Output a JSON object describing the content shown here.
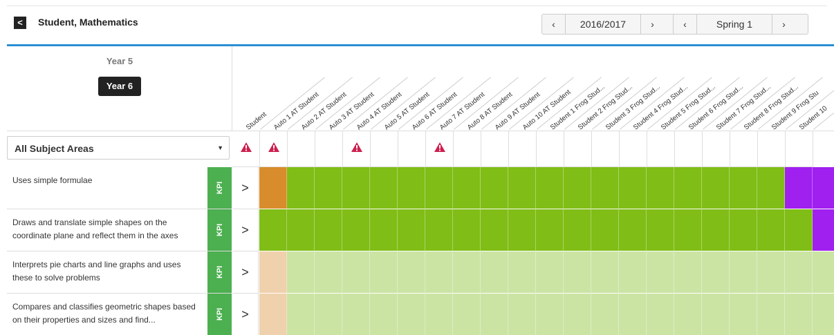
{
  "header": {
    "back_glyph": "<",
    "title": "Student, Mathematics",
    "year_value": "2016/2017",
    "term_value": "Spring 1",
    "prev_glyph": "‹",
    "next_glyph": "›"
  },
  "year_filter": {
    "inactive": "Year 5",
    "active": "Year 6"
  },
  "subject_filter": {
    "selected": "All Subject Areas",
    "caret": "▼"
  },
  "columns": [
    "Student",
    "Auto 1 AT Student",
    "Auto 2 AT Student",
    "Auto 3 AT Student",
    "Auto 4 AT Student",
    "Auto 5 AT Student",
    "Auto 6 AT Student",
    "Auto 7 AT Student",
    "Auto 8 AT Student",
    "Auto 9 AT Student",
    "Auto 10 AT Student",
    "Student 1 Frog Stud...",
    "Student 2 Frog Stud...",
    "Student 3 Frog Stud...",
    "Student 4 Frog Stud...",
    "Student 5 Frog Stud...",
    "Student 6 Frog Stud...",
    "Student 7 Frog Stud...",
    "Student 8 Frog Stud...",
    "Student 9 Frog Stu",
    "Student 10"
  ],
  "warning_flags": [
    true,
    true,
    false,
    false,
    true,
    false,
    false,
    true,
    false,
    false,
    false,
    false,
    false,
    false,
    false,
    false,
    false,
    false,
    false,
    false,
    false
  ],
  "colors": {
    "warning": "#cc1f4f",
    "orange": "#d98c2b",
    "green": "#80bd16",
    "purple": "#a020f0",
    "light_orange": "#f0d1ad",
    "light_green": "#cbe4a4",
    "kpi": "#4caf50",
    "accent": "#2a8fd4"
  },
  "rows": [
    {
      "description": "Uses simple formulae",
      "kpi": "KPI",
      "chevron": ">",
      "cells": [
        "orange",
        "green",
        "green",
        "green",
        "green",
        "green",
        "green",
        "green",
        "green",
        "green",
        "green",
        "green",
        "green",
        "green",
        "green",
        "green",
        "green",
        "green",
        "green",
        "purple",
        "purple"
      ]
    },
    {
      "description": "Draws and translate simple shapes on the coordinate plane and reflect them in the axes",
      "kpi": "KPI",
      "chevron": ">",
      "cells": [
        "green",
        "green",
        "green",
        "green",
        "green",
        "green",
        "green",
        "green",
        "green",
        "green",
        "green",
        "green",
        "green",
        "green",
        "green",
        "green",
        "green",
        "green",
        "green",
        "green",
        "purple"
      ]
    },
    {
      "description": "Interprets pie charts and line graphs and uses these to solve problems",
      "kpi": "KPI",
      "chevron": ">",
      "cells": [
        "light_orange",
        "light_green",
        "light_green",
        "light_green",
        "light_green",
        "light_green",
        "light_green",
        "light_green",
        "light_green",
        "light_green",
        "light_green",
        "light_green",
        "light_green",
        "light_green",
        "light_green",
        "light_green",
        "light_green",
        "light_green",
        "light_green",
        "light_green",
        "light_green"
      ]
    },
    {
      "description": "Compares and classifies geometric shapes based on their properties and sizes and find...",
      "kpi": "KPI",
      "chevron": ">",
      "cells": [
        "light_orange",
        "light_green",
        "light_green",
        "light_green",
        "light_green",
        "light_green",
        "light_green",
        "light_green",
        "light_green",
        "light_green",
        "light_green",
        "light_green",
        "light_green",
        "light_green",
        "light_green",
        "light_green",
        "light_green",
        "light_green",
        "light_green",
        "light_green",
        "light_green"
      ]
    }
  ]
}
